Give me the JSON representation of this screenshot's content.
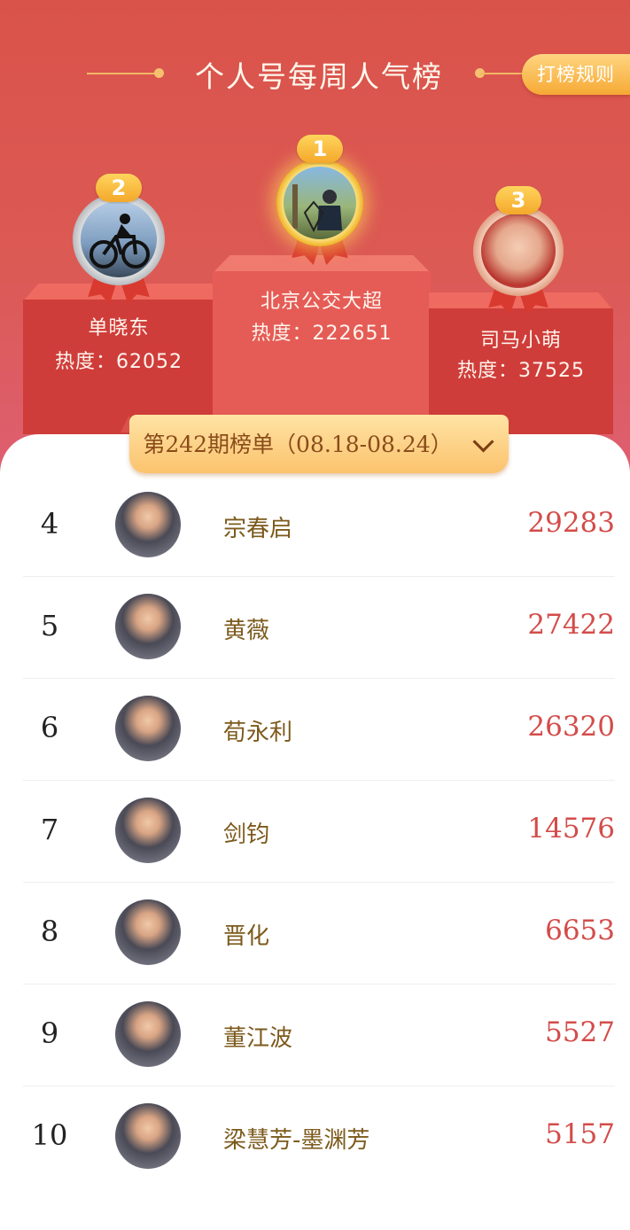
{
  "header": {
    "title": "个人号每周人气榜",
    "rules_button": "打榜规则"
  },
  "podium": {
    "first": {
      "rank": "1",
      "name": "北京公交大超",
      "heat": "热度：222651"
    },
    "second": {
      "rank": "2",
      "name": "单晓东",
      "heat": "热度：62052"
    },
    "third": {
      "rank": "3",
      "name": "司马小萌",
      "heat": "热度：37525"
    }
  },
  "period_selector": {
    "label": "第242期榜单（08.18-08.24）"
  },
  "ranking": [
    {
      "rank": "4",
      "name": "宗春启",
      "score": "29283"
    },
    {
      "rank": "5",
      "name": "黄薇",
      "score": "27422"
    },
    {
      "rank": "6",
      "name": "荀永利",
      "score": "26320"
    },
    {
      "rank": "7",
      "name": "剑钧",
      "score": "14576"
    },
    {
      "rank": "8",
      "name": "晋化",
      "score": "6653"
    },
    {
      "rank": "9",
      "name": "董江波",
      "score": "5527"
    },
    {
      "rank": "10",
      "name": "梁慧芳-墨渊芳",
      "score": "5157"
    }
  ],
  "colors": {
    "header_red": "#d9534a",
    "score_red": "#d34c49",
    "name_brown": "#7c5a1c",
    "gold": "#f4a82b"
  },
  "icons": {
    "dropdown": "chevron-down-icon",
    "medal_gold": "gold-medal-icon",
    "medal_silver": "silver-medal-icon",
    "medal_bronze": "bronze-medal-icon"
  }
}
